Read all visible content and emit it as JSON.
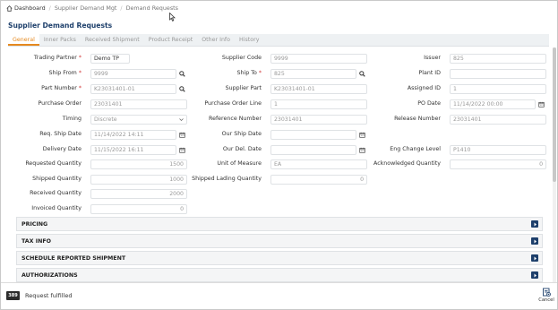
{
  "breadcrumb": {
    "home": "Dashboard",
    "items": [
      "Supplier Demand Mgt",
      "Demand Requests"
    ]
  },
  "page_title": "Supplier Demand Requests",
  "tabs": [
    "General",
    "Inner Packs",
    "Received Shipment",
    "Product Receipt",
    "Other Info",
    "History"
  ],
  "form": {
    "trading_partner": {
      "label": "Trading Partner",
      "value": "Demo TP"
    },
    "ship_from": {
      "label": "Ship From",
      "value": "9999"
    },
    "part_number": {
      "label": "Part Number",
      "value": "K23031401-01"
    },
    "purchase_order": {
      "label": "Purchase Order",
      "value": "23031401"
    },
    "timing": {
      "label": "Timing",
      "value": "Discrete"
    },
    "req_ship_date": {
      "label": "Req. Ship Date",
      "value": "11/14/2022 14:11"
    },
    "delivery_date": {
      "label": "Delivery Date",
      "value": "11/15/2022 16:11"
    },
    "requested_quantity": {
      "label": "Requested Quantity",
      "value": "1500"
    },
    "shipped_quantity": {
      "label": "Shipped Quantity",
      "value": "1000"
    },
    "received_quantity": {
      "label": "Received Quantity",
      "value": "2000"
    },
    "invoiced_quantity": {
      "label": "Invoiced Quantity",
      "value": "0"
    },
    "supplier_code": {
      "label": "Supplier Code",
      "value": "9999"
    },
    "ship_to": {
      "label": "Ship To",
      "value": "825"
    },
    "supplier_part": {
      "label": "Supplier Part",
      "value": "K23031401-01"
    },
    "purchase_order_line": {
      "label": "Purchase Order Line",
      "value": "1"
    },
    "reference_number": {
      "label": "Reference Number",
      "value": "23031401"
    },
    "our_ship_date": {
      "label": "Our Ship Date",
      "value": ""
    },
    "our_del_date": {
      "label": "Our Del. Date",
      "value": ""
    },
    "unit_of_measure": {
      "label": "Unit of Measure",
      "value": "EA"
    },
    "shipped_lading_quantity": {
      "label": "Shipped Lading Quantity",
      "value": "0"
    },
    "issuer": {
      "label": "Issuer",
      "value": "825"
    },
    "plant_id": {
      "label": "Plant ID",
      "value": ""
    },
    "assigned_id": {
      "label": "Assigned ID",
      "value": "1"
    },
    "po_date": {
      "label": "PO Date",
      "value": "11/14/2022 00:00"
    },
    "release_number": {
      "label": "Release Number",
      "value": "23031401"
    },
    "eng_change_level": {
      "label": "Eng Change Level",
      "value": "P1410"
    },
    "acknowledged_quantity": {
      "label": "Acknowledged Quantity",
      "value": "0"
    }
  },
  "sections": [
    "PRICING",
    "TAX INFO",
    "SCHEDULE REPORTED SHIPMENT",
    "AUTHORIZATIONS"
  ],
  "footer": {
    "badge": "389",
    "status": "Request fulfilled",
    "cancel_label": "Cancel"
  },
  "colors": {
    "accent": "#e5891e",
    "title": "#1d3f6b",
    "required": "#d23b3b"
  }
}
